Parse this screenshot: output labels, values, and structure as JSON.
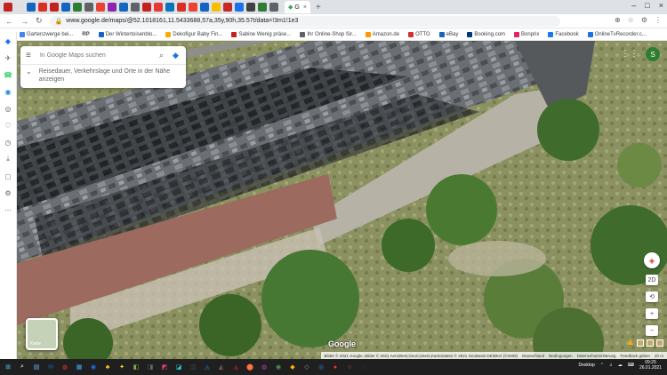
{
  "browser": {
    "tab_colors": [
      "#c5221f",
      "#e0e0e0",
      "#1565c0",
      "#d93025",
      "#c5221f",
      "#1565c0",
      "#2e7d32",
      "#5f6368",
      "#ea4335",
      "#8e24aa",
      "#1565c0",
      "#5f6368",
      "#c5221f",
      "#e53935",
      "#0277bd",
      "#d93025",
      "#ea4335",
      "#1565c0",
      "#fbbc04",
      "#c62828",
      "#1a73e8",
      "#424242",
      "#2e7d32",
      "#5f6368"
    ],
    "active_tab_label": "G",
    "active_tab_close": "×",
    "new_tab": "+",
    "window_controls": [
      "–",
      "□",
      "×"
    ],
    "back": "←",
    "forward": "→",
    "reload": "↻",
    "lock_icon": "🔒",
    "url": "www.google.de/maps/@52.1018161,11.5433688,57a,35y,90h,35.57t/data=!3m1!1e3",
    "toolbar_icons": [
      "⊕",
      "☆",
      "⚙",
      "⋮"
    ]
  },
  "bookmarks": [
    {
      "label": "Gartenzwerge bei...",
      "color": "#4285f4"
    },
    {
      "label": "Der Wintertoisenblo...",
      "color": "#1565c0"
    },
    {
      "label": "Dekofigur Baby Fin...",
      "color": "#f9ab00"
    },
    {
      "label": "Sabine Wenig präse...",
      "color": "#c5221f"
    },
    {
      "label": "Ihr Online-Shop für...",
      "color": "#5f6368"
    },
    {
      "label": "Amazon.de",
      "color": "#ff9900"
    },
    {
      "label": "OTTO",
      "color": "#d32f2f"
    },
    {
      "label": "eBay",
      "color": "#1565c0"
    },
    {
      "label": "Booking.com",
      "color": "#003580"
    },
    {
      "label": "Bonprix",
      "color": "#e91e63"
    },
    {
      "label": "Facebook",
      "color": "#1877f2"
    },
    {
      "label": "OnlineTvRecorder.c...",
      "color": "#1a73e8"
    }
  ],
  "bookmark_prefix": "RP",
  "sidebar": {
    "icons": [
      "◆",
      "✈",
      "☎",
      "◉",
      "◎",
      "♡",
      "◷",
      "⤓",
      "◻",
      "⚙",
      "⋯"
    ],
    "colors": [
      "#1a73e8",
      "#5f6368",
      "#25d366",
      "#1e88e5",
      "#5f6368",
      "#5f6368",
      "#5f6368",
      "#5f6368",
      "#5f6368",
      "#5f6368",
      "#5f6368"
    ]
  },
  "maps": {
    "search_placeholder": "In Google Maps suchen",
    "search_icon": "⌕",
    "directions_icon": "◆",
    "hint_line1": "Reisedauer, Verkehrslage und Orte in der Nähe",
    "hint_line2": "anzeigen",
    "hint_chevron": "⌄",
    "menu_icon": "≡",
    "apps_icon": "⋮⋮",
    "avatar_letter": "S",
    "layer_label": "Karte",
    "google_logo": "Google",
    "compass_icon": "◈",
    "zoom_in": "+",
    "zoom_out": "−",
    "tilt_label": "2D",
    "rotate_icon": "⟲",
    "pegman_icon": "♟",
    "attribution": [
      "Bilder © 2021 Google, Bilder © 2021 AeroWest,GeoContent,Kartendaten © 2021 GeoBasis-DE/BKG (©2009)",
      "Deutschland",
      "Bedingungen",
      "Datenschutzerklärung",
      "Feedback geben",
      "20 m"
    ]
  },
  "taskbar": {
    "icons": [
      "⊞",
      "⌕",
      "▤",
      "✉",
      "◍",
      "▦",
      "◉",
      "♣",
      "✦",
      "◧",
      "◨",
      "◩",
      "◪",
      "◫",
      "◬",
      "◭",
      "◮",
      "⬤",
      "◍",
      "◉",
      "◆",
      "◇",
      "◎",
      "●",
      "○",
      "◌"
    ],
    "colors": [
      "#4fc3f7",
      "#ffffff",
      "#64b5f6",
      "#1565c0",
      "#e53935",
      "#42a5f5",
      "#1a73e8",
      "#ffca28",
      "#fdd835",
      "#7cb342",
      "#546e7a",
      "#ec407a",
      "#26c6da",
      "#455a64",
      "#1e88e5",
      "#8d6e63",
      "#b71c1c",
      "#ff7043",
      "#ab47bc",
      "#43a047",
      "#ffb300",
      "#90a4ae",
      "#1e88e5",
      "#e53935",
      "#ff5722",
      "#2e7d32"
    ],
    "desktop_label": "Desktop",
    "tray_icons": [
      "⌃",
      "♫",
      "☁",
      "⌨"
    ],
    "time": "09:25",
    "date": "26.01.2021"
  }
}
